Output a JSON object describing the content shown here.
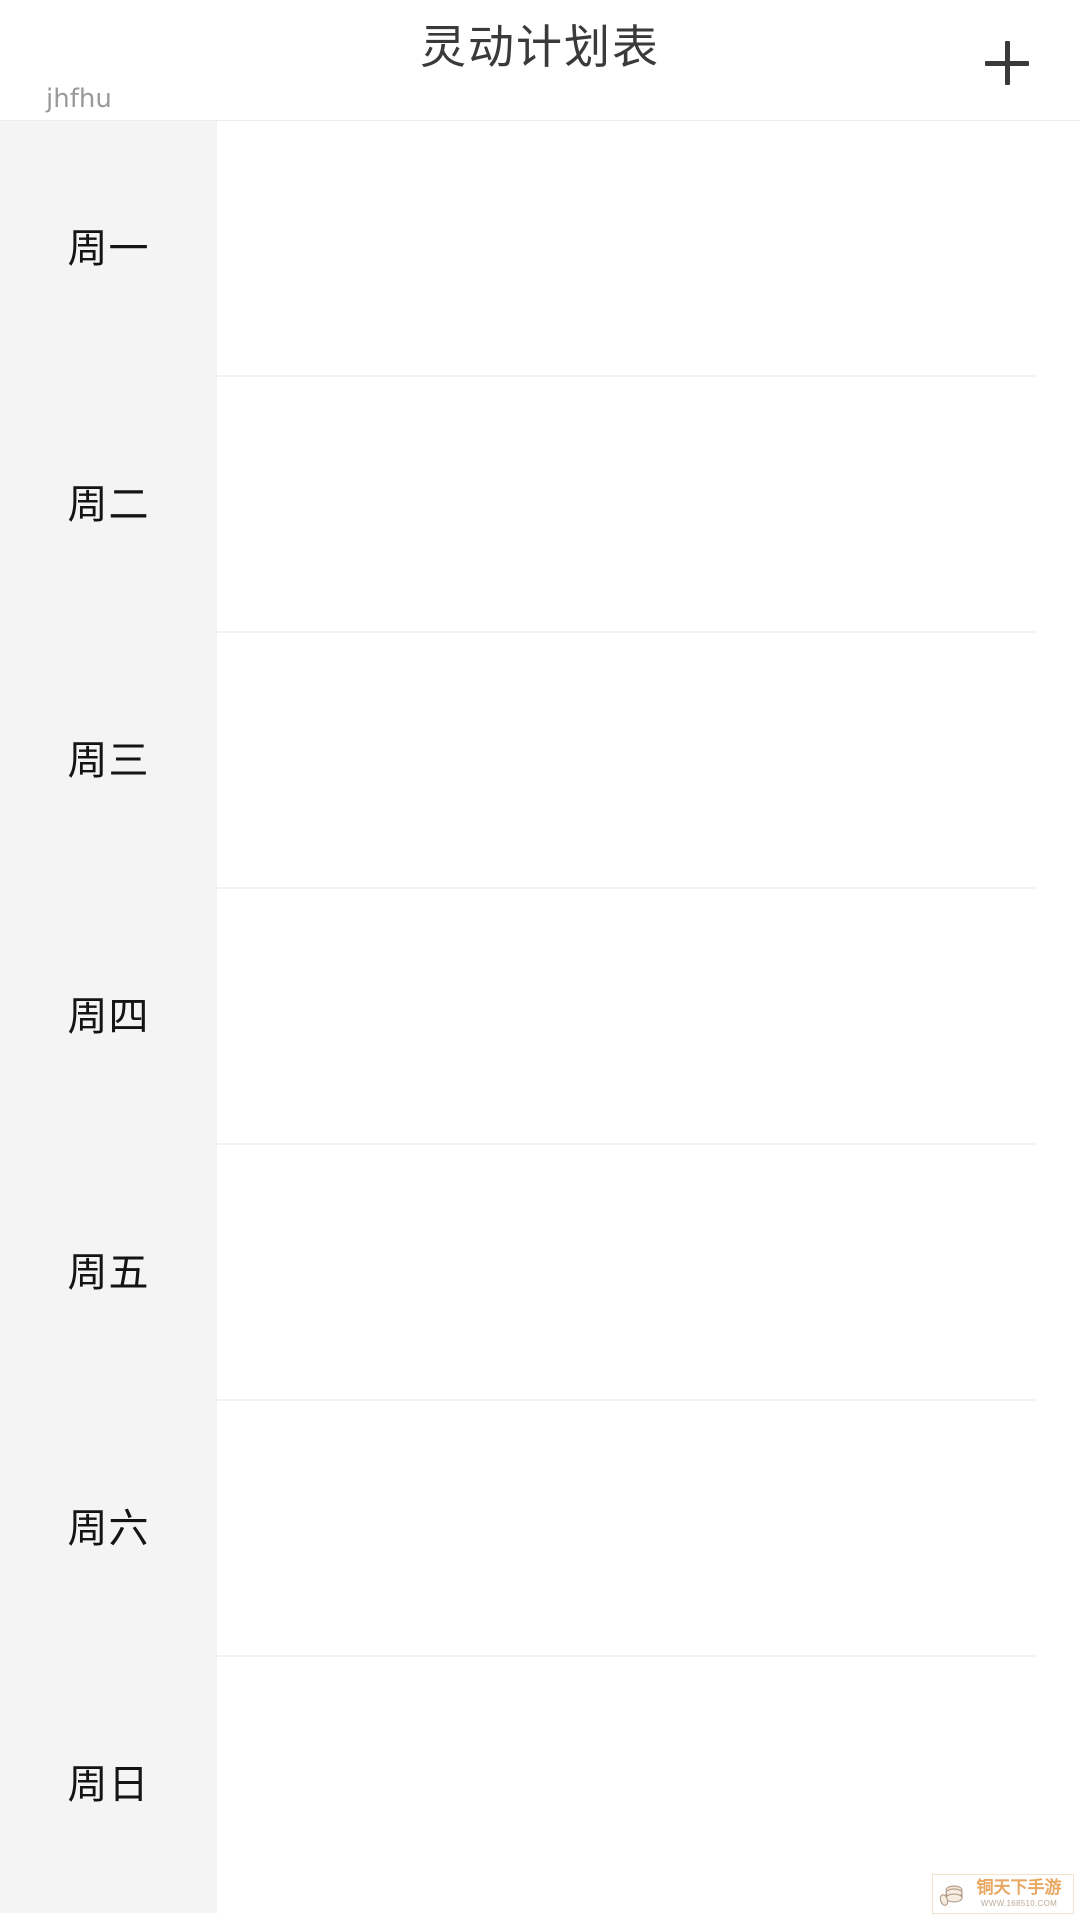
{
  "header": {
    "title": "灵动计划表",
    "subtitle": "jhfhu",
    "add_icon": "plus-icon",
    "add_label": "+"
  },
  "schedule": {
    "rows": [
      {
        "label": "周一",
        "items": []
      },
      {
        "label": "周二",
        "items": []
      },
      {
        "label": "周三",
        "items": []
      },
      {
        "label": "周四",
        "items": []
      },
      {
        "label": "周五",
        "items": []
      },
      {
        "label": "周六",
        "items": []
      },
      {
        "label": "周日",
        "items": []
      }
    ]
  },
  "watermark": {
    "brand": "铜天下手游",
    "url": "WWW.168510.COM",
    "icon": "coins-icon"
  },
  "colors": {
    "page_background": "#ffffff",
    "sidebar_background": "#f4f4f4",
    "divider": "#f2f2f2",
    "header_border": "#ececec",
    "title_text": "#3a3a3a",
    "day_text": "#141414",
    "subtitle_text": "#9a9a9a",
    "watermark_brand": "#eaa45c"
  }
}
